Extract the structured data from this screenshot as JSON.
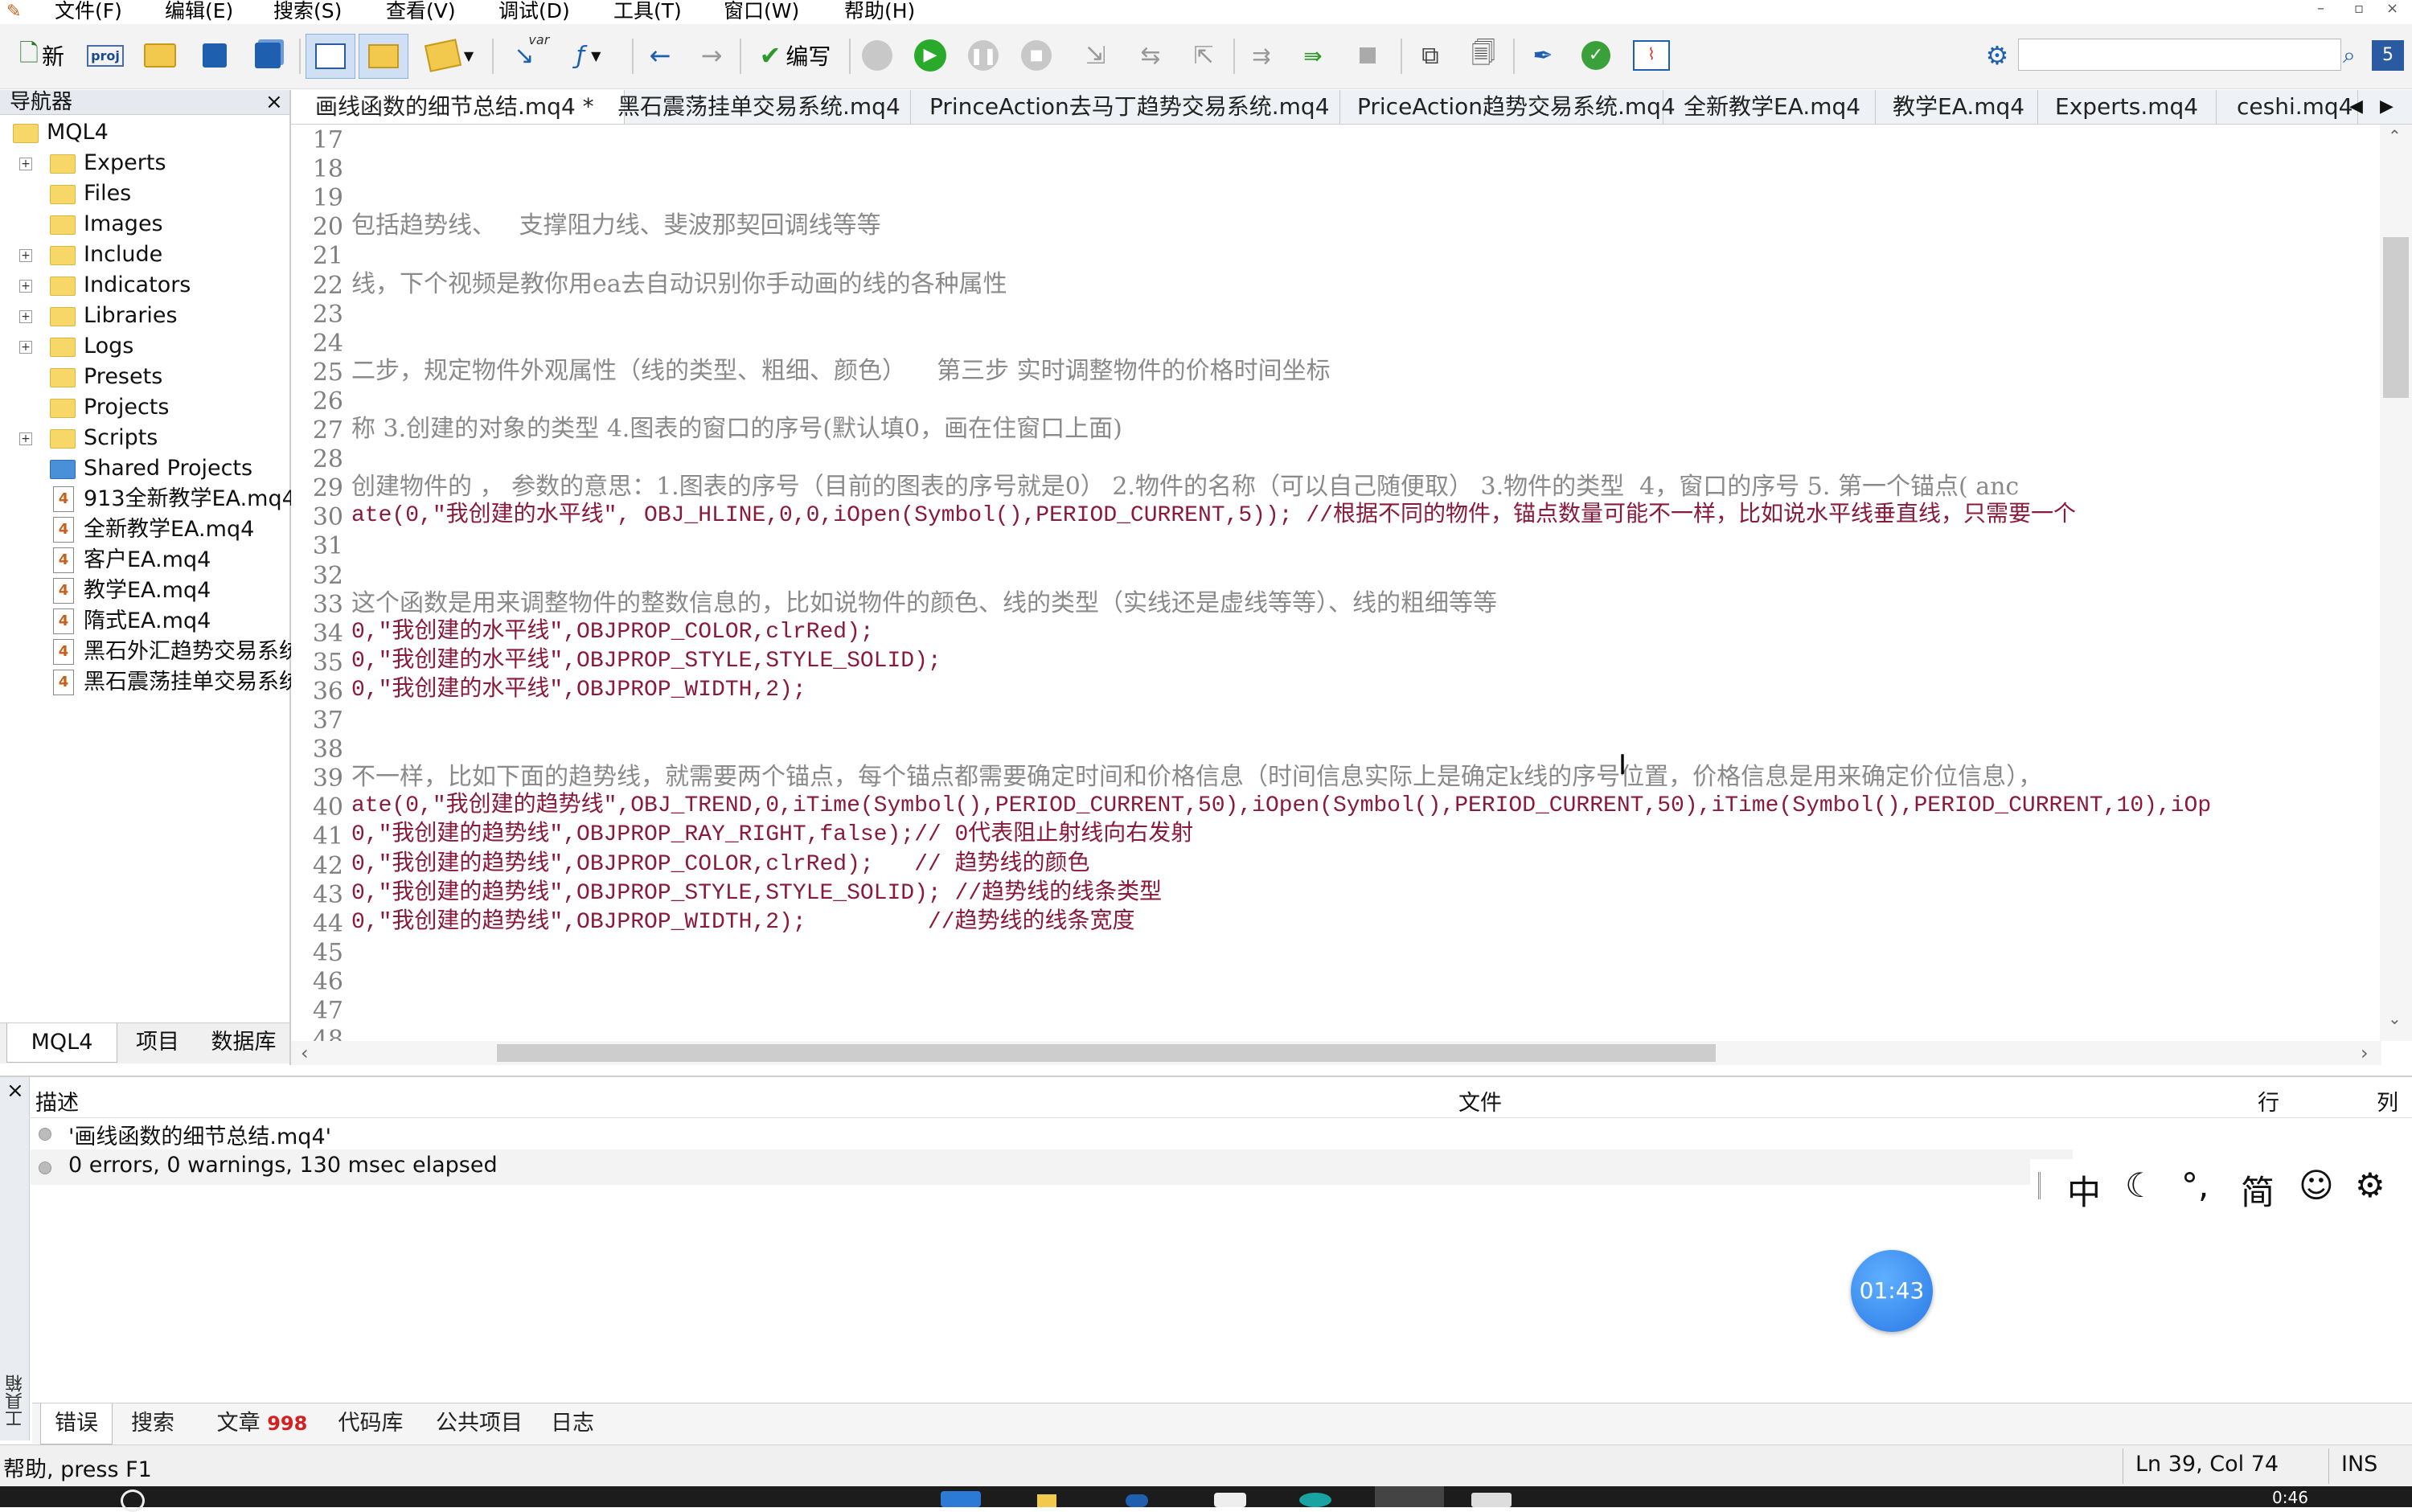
{
  "menu": [
    "文件(F)",
    "编辑(E)",
    "搜索(S)",
    "查看(V)",
    "调试(D)",
    "工具(T)",
    "窗口(W)",
    "帮助(H)"
  ],
  "toolbar": {
    "new_label": "新",
    "compile_label": "编写",
    "var_label": "var",
    "proj_label": "proj"
  },
  "navigator": {
    "title": "导航器",
    "root": "MQL4",
    "items": [
      {
        "label": "Experts",
        "kind": "folder",
        "expandable": true
      },
      {
        "label": "Files",
        "kind": "folder",
        "expandable": false
      },
      {
        "label": "Images",
        "kind": "folder",
        "expandable": false
      },
      {
        "label": "Include",
        "kind": "folder",
        "expandable": true
      },
      {
        "label": "Indicators",
        "kind": "folder",
        "expandable": true
      },
      {
        "label": "Libraries",
        "kind": "folder",
        "expandable": true
      },
      {
        "label": "Logs",
        "kind": "folder",
        "expandable": true
      },
      {
        "label": "Presets",
        "kind": "folder",
        "expandable": false
      },
      {
        "label": "Projects",
        "kind": "folder",
        "expandable": false
      },
      {
        "label": "Scripts",
        "kind": "folder",
        "expandable": true
      },
      {
        "label": "Shared Projects",
        "kind": "folder-blue",
        "expandable": false
      },
      {
        "label": "913全新教学EA.mq4",
        "kind": "file",
        "expandable": false
      },
      {
        "label": "全新教学EA.mq4",
        "kind": "file",
        "expandable": false
      },
      {
        "label": "客户EA.mq4",
        "kind": "file",
        "expandable": false
      },
      {
        "label": "教学EA.mq4",
        "kind": "file",
        "expandable": false
      },
      {
        "label": "隋式EA.mq4",
        "kind": "file",
        "expandable": false
      },
      {
        "label": "黑石外汇趋势交易系统",
        "kind": "file",
        "expandable": false
      },
      {
        "label": "黑石震荡挂单交易系统",
        "kind": "file",
        "expandable": false
      }
    ],
    "tabs": [
      "MQL4",
      "项目",
      "数据库"
    ]
  },
  "editor": {
    "tabs": [
      "画线函数的细节总结.mq4 *",
      "黑石震荡挂单交易系统.mq4",
      "PrinceAction去马丁趋势交易系统.mq4",
      "PriceAction趋势交易系统.mq4",
      "全新教学EA.mq4",
      "教学EA.mq4",
      "Experts.mq4",
      "ceshi.mq4"
    ],
    "lines": [
      {
        "n": "17",
        "t": "",
        "k": "cm"
      },
      {
        "n": "18",
        "t": "",
        "k": "cm"
      },
      {
        "n": "19",
        "t": "",
        "k": "cm"
      },
      {
        "n": "20",
        "t": "包括趋势线、   支撑阻力线、斐波那契回调线等等",
        "k": "cm"
      },
      {
        "n": "21",
        "t": "",
        "k": "cm"
      },
      {
        "n": "22",
        "t": "线，下个视频是教你用ea去自动识别你手动画的线的各种属性",
        "k": "cm"
      },
      {
        "n": "23",
        "t": "",
        "k": "cm"
      },
      {
        "n": "24",
        "t": "",
        "k": "cm"
      },
      {
        "n": "25",
        "t": "二步，规定物件外观属性（线的类型、粗细、颜色）    第三步 实时调整物件的价格时间坐标",
        "k": "cm"
      },
      {
        "n": "26",
        "t": "",
        "k": "cm"
      },
      {
        "n": "27",
        "t": "称 3.创建的对象的类型 4.图表的窗口的序号(默认填0，画在住窗口上面)",
        "k": "cm"
      },
      {
        "n": "28",
        "t": "",
        "k": "cm"
      },
      {
        "n": "29",
        "t": "创建物件的 ， 参数的意思：1.图表的序号（目前的图表的序号就是0） 2.物件的名称（可以自己随便取） 3.物件的类型  4，窗口的序号 5. 第一个锚点( anc",
        "k": "cm"
      },
      {
        "n": "30",
        "t": "ate(0,\"我创建的水平线\", OBJ_HLINE,0,0,iOpen(Symbol(),PERIOD_CURRENT,5)); //根据不同的物件，锚点数量可能不一样，比如说水平线垂直线，只需要一个",
        "k": "cd"
      },
      {
        "n": "31",
        "t": "",
        "k": "cm"
      },
      {
        "n": "32",
        "t": "",
        "k": "cm"
      },
      {
        "n": "33",
        "t": "这个函数是用来调整物件的整数信息的，比如说物件的颜色、线的类型（实线还是虚线等等）、线的粗细等等",
        "k": "cm"
      },
      {
        "n": "34",
        "t": "0,\"我创建的水平线\",OBJPROP_COLOR,clrRed);",
        "k": "cd"
      },
      {
        "n": "35",
        "t": "0,\"我创建的水平线\",OBJPROP_STYLE,STYLE_SOLID);",
        "k": "cd"
      },
      {
        "n": "36",
        "t": "0,\"我创建的水平线\",OBJPROP_WIDTH,2);",
        "k": "cd"
      },
      {
        "n": "37",
        "t": "",
        "k": "cm"
      },
      {
        "n": "38",
        "t": "",
        "k": "cm"
      },
      {
        "n": "39",
        "t": "不一样，比如下面的趋势线，就需要两个锚点，每个锚点都需要确定时间和价格信息（时间信息实际上是确定k线的序号位置，价格信息是用来确定价位信息），",
        "k": "cm"
      },
      {
        "n": "40",
        "t": "ate(0,\"我创建的趋势线\",OBJ_TREND,0,iTime(Symbol(),PERIOD_CURRENT,50),iOpen(Symbol(),PERIOD_CURRENT,50),iTime(Symbol(),PERIOD_CURRENT,10),iOp",
        "k": "cd"
      },
      {
        "n": "41",
        "t": "0,\"我创建的趋势线\",OBJPROP_RAY_RIGHT,false);// 0代表阻止射线向右发射",
        "k": "cd"
      },
      {
        "n": "42",
        "t": "0,\"我创建的趋势线\",OBJPROP_COLOR,clrRed);   // 趋势线的颜色",
        "k": "cd"
      },
      {
        "n": "43",
        "t": "0,\"我创建的趋势线\",OBJPROP_STYLE,STYLE_SOLID); //趋势线的线条类型",
        "k": "cd"
      },
      {
        "n": "44",
        "t": "0,\"我创建的趋势线\",OBJPROP_WIDTH,2);         //趋势线的线条宽度",
        "k": "cd"
      },
      {
        "n": "45",
        "t": "",
        "k": "cm"
      },
      {
        "n": "46",
        "t": "",
        "k": "cm"
      },
      {
        "n": "47",
        "t": "",
        "k": "cm"
      },
      {
        "n": "48",
        "t": "",
        "k": "cm"
      }
    ]
  },
  "toolbox": {
    "side_label": "工具箱",
    "columns": {
      "desc": "描述",
      "file": "文件",
      "line": "行",
      "col": "列"
    },
    "messages": [
      "'画线函数的细节总结.mq4'",
      "0 errors, 0 warnings, 130 msec elapsed"
    ],
    "tabs": [
      {
        "label": "错误",
        "badge": ""
      },
      {
        "label": "搜索",
        "badge": ""
      },
      {
        "label": "文章",
        "badge": "998"
      },
      {
        "label": "代码库",
        "badge": ""
      },
      {
        "label": "公共项目",
        "badge": ""
      },
      {
        "label": "日志",
        "badge": ""
      }
    ]
  },
  "ime": {
    "lang": "中",
    "width": "简"
  },
  "timer": "01:43",
  "status": {
    "help": "帮助, press F1",
    "position": "Ln 39, Col 74",
    "mode": "INS"
  },
  "taskbar": {
    "clock": "0:46"
  },
  "colors": {
    "comment": "#8a8a8a",
    "code": "#8a1a3a",
    "string": "#1a8a8a",
    "accent": "#2979e6",
    "badge": "#d32020"
  }
}
